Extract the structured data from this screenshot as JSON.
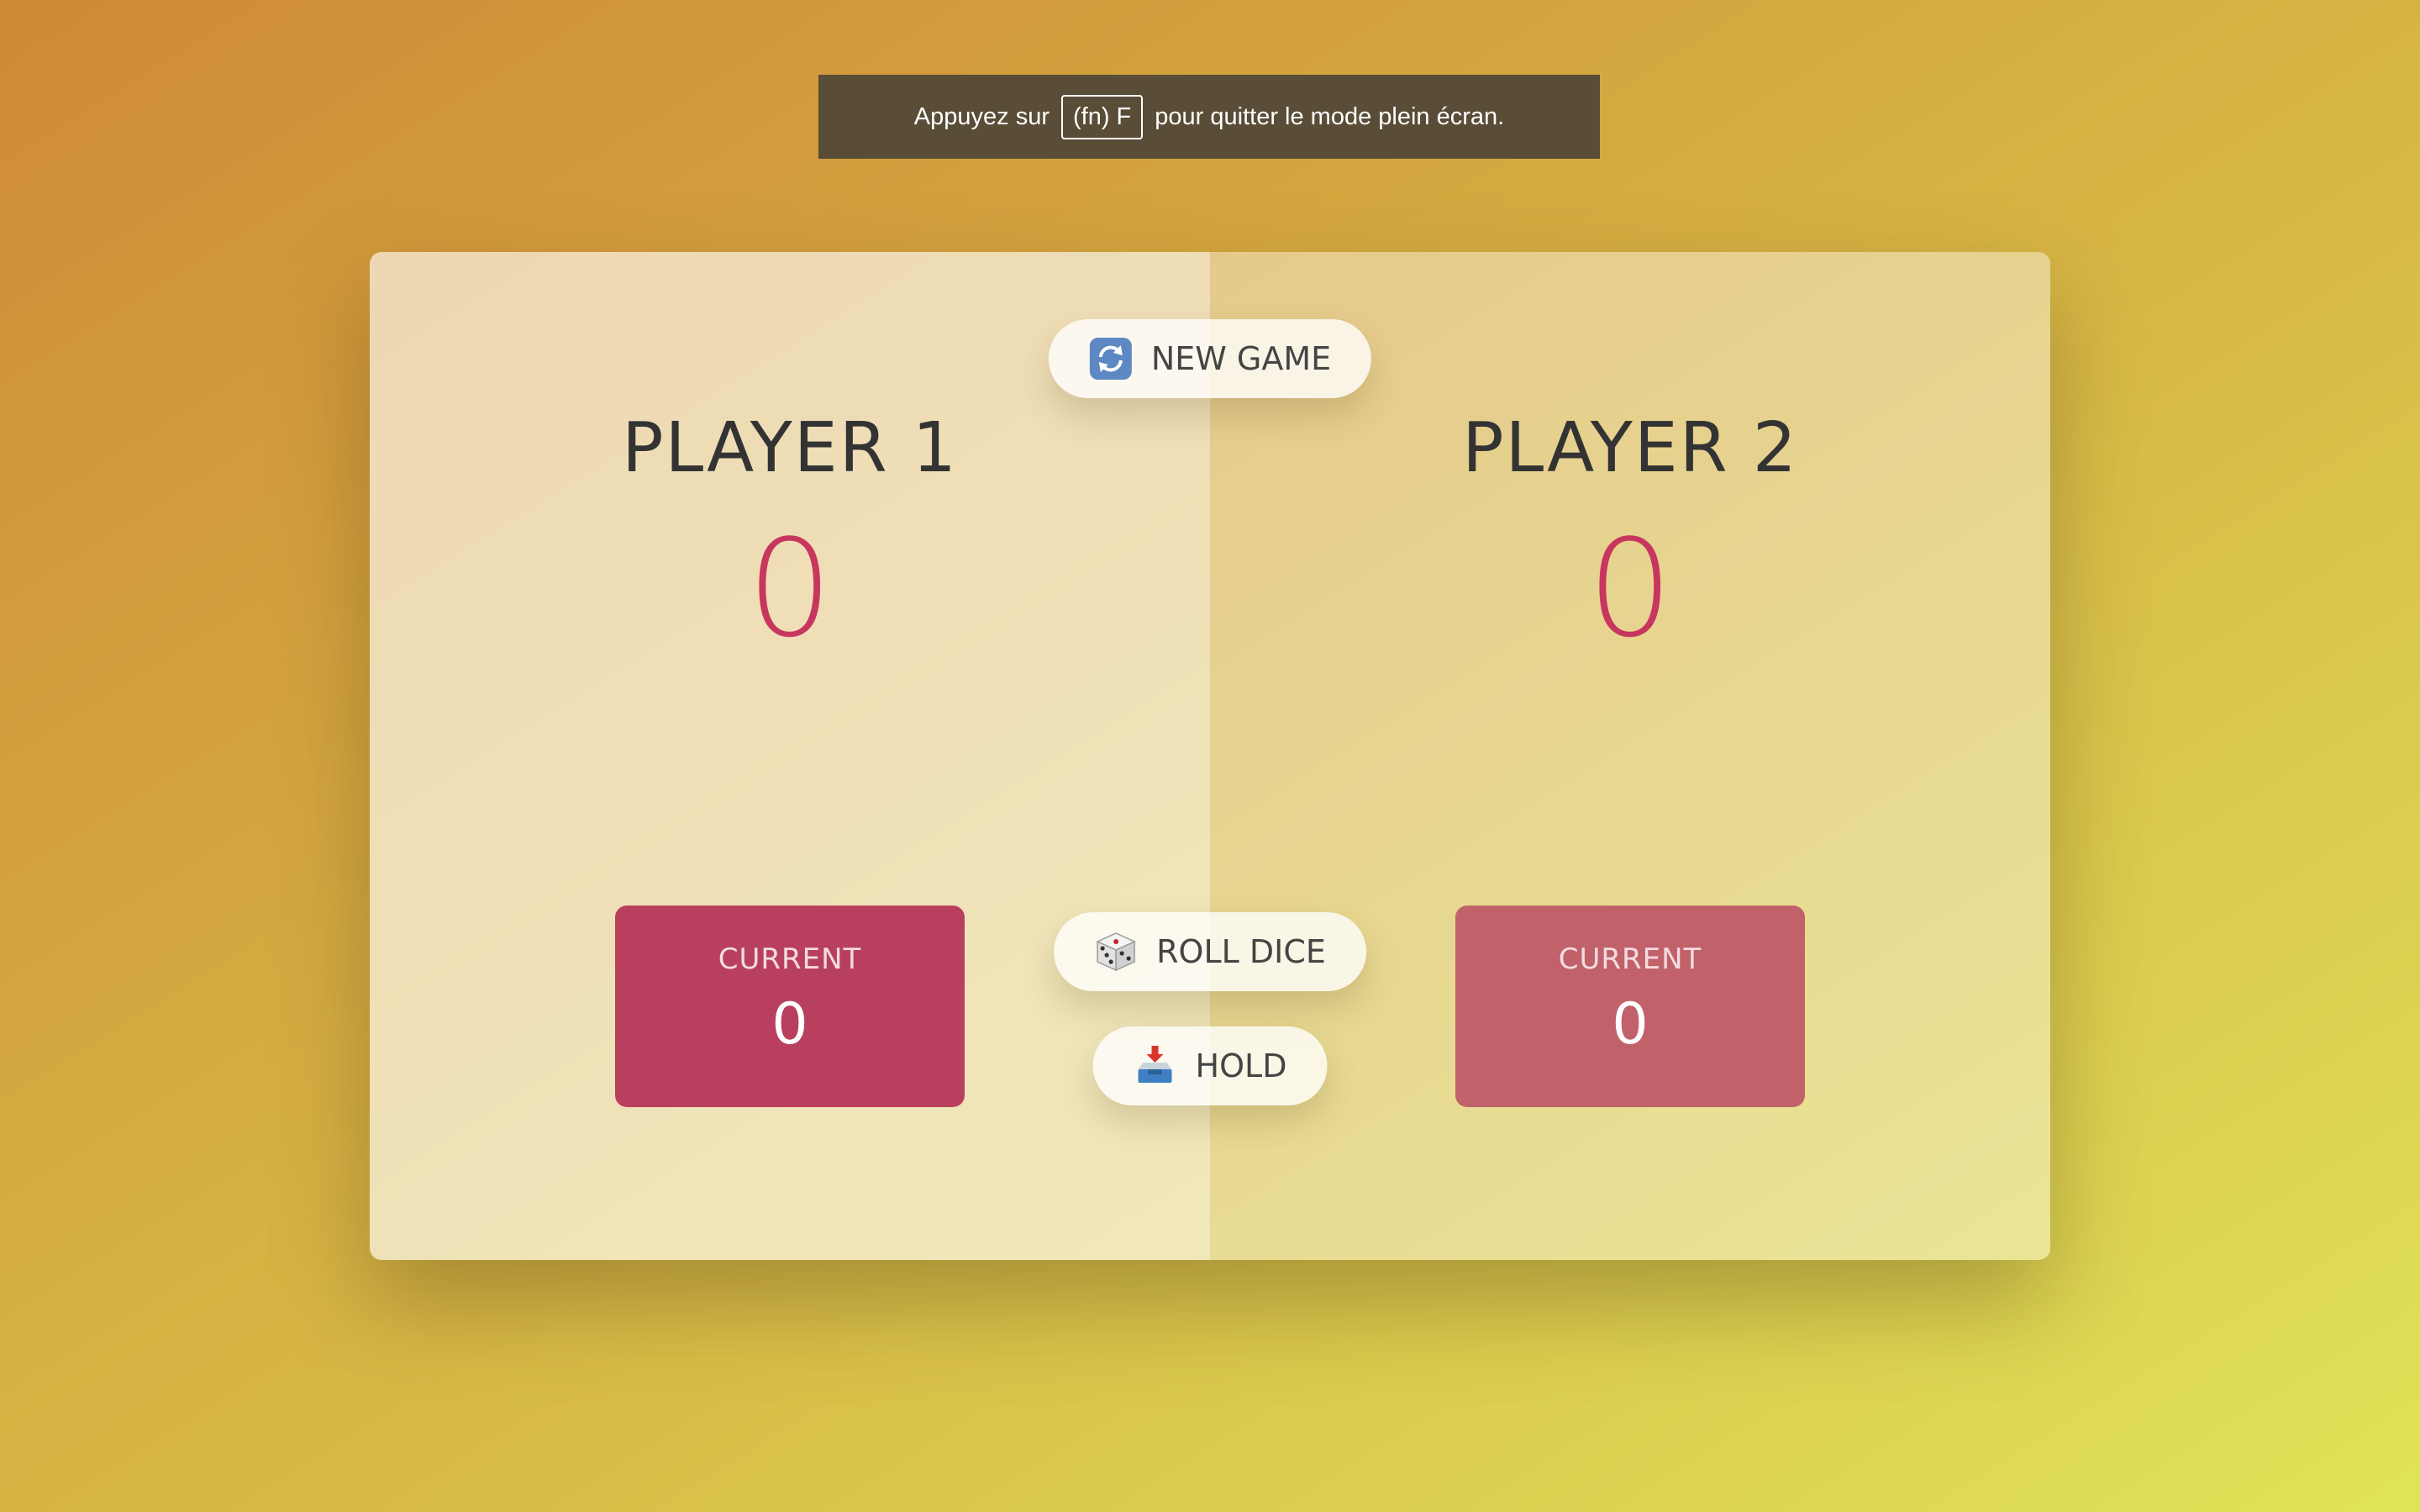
{
  "banner": {
    "before": "Appuyez sur",
    "key": "(fn) F",
    "after": "pour quitter le mode plein écran."
  },
  "players": [
    {
      "name": "PLAYER 1",
      "score": "0",
      "current_label": "CURRENT",
      "current_score": "0",
      "active": true
    },
    {
      "name": "PLAYER 2",
      "score": "0",
      "current_label": "CURRENT",
      "current_score": "0",
      "active": false
    }
  ],
  "buttons": {
    "new_game": {
      "label": "NEW GAME",
      "icon": "refresh-icon"
    },
    "roll_dice": {
      "label": "ROLL DICE",
      "icon": "dice-icon"
    },
    "hold": {
      "label": "HOLD",
      "icon": "inbox-tray-icon"
    }
  },
  "colors": {
    "score": "#c7365f",
    "current_active": "#b8405e",
    "current_inactive": "#c1626a",
    "banner_bg": "#594d37"
  }
}
